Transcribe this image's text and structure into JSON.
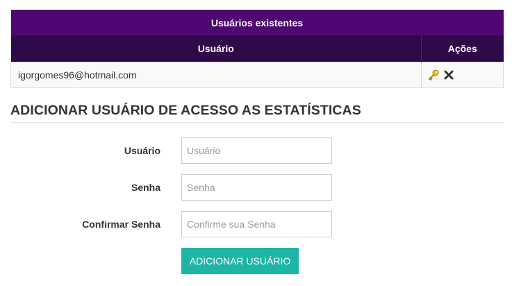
{
  "users_table": {
    "caption": "Usuários existentes",
    "columns": {
      "user": "Usuário",
      "actions": "Ações"
    },
    "rows": [
      {
        "user": "igorgomes96@hotmail.com"
      }
    ],
    "icons": {
      "edit": "key-icon",
      "delete": "close-icon"
    },
    "colors": {
      "caption_bg": "#4f0672",
      "header_bg": "#2e0a49"
    }
  },
  "add_user": {
    "title": "ADICIONAR USUÁRIO DE ACESSO AS ESTATÍSTICAS",
    "fields": {
      "user": {
        "label": "Usuário",
        "placeholder": "Usuário",
        "value": ""
      },
      "password": {
        "label": "Senha",
        "placeholder": "Senha",
        "value": ""
      },
      "confirm": {
        "label": "Confirmar Senha",
        "placeholder": "Confirme sua Senha",
        "value": ""
      }
    },
    "submit_label": "ADICIONAR USUÁRIO",
    "colors": {
      "submit_bg": "#1fb5a5"
    }
  }
}
